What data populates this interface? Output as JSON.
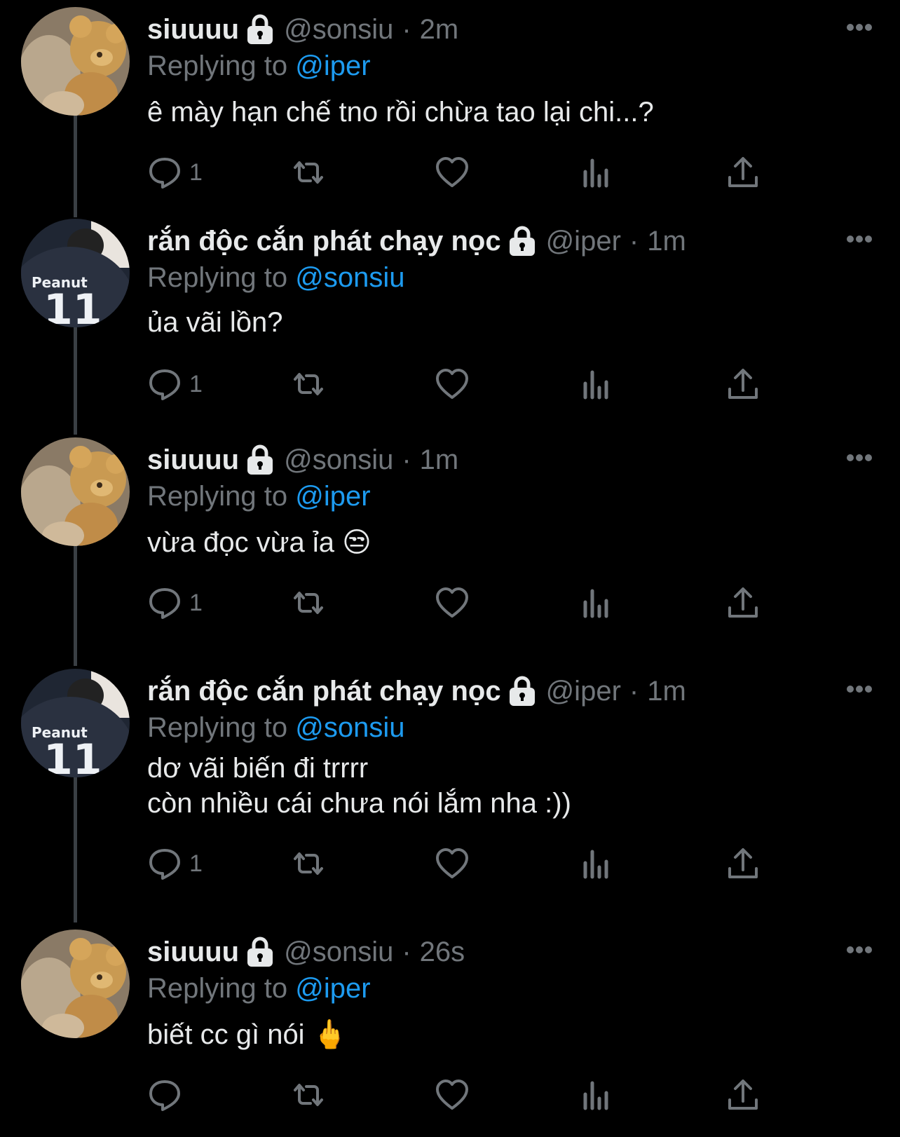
{
  "colors": {
    "background": "#000000",
    "text": "#e7e9ea",
    "muted": "#71767b",
    "link": "#1d9bf0"
  },
  "tweets": [
    {
      "name": "siuuuu",
      "handle": "@sonsiu",
      "separator": "·",
      "time": "2m",
      "replying_prefix": "Replying to",
      "replying_to": "@iper",
      "text": "ê mày hạn chế tno rồi chừa tao lại chi...?",
      "reply_count": "1",
      "avatar": "teddy-bear-avatar"
    },
    {
      "name": "rắn độc cắn phát chạy nọc",
      "handle": "@iper",
      "separator": "·",
      "time": "1m",
      "replying_prefix": "Replying to",
      "replying_to": "@sonsiu",
      "text": "ủa vãi lồn?",
      "reply_count": "1",
      "avatar": "peanut-jersey-avatar",
      "jersey_name": "Peanut",
      "jersey_number": "11"
    },
    {
      "name": "siuuuu",
      "handle": "@sonsiu",
      "separator": "·",
      "time": "1m",
      "replying_prefix": "Replying to",
      "replying_to": "@iper",
      "text": "vừa đọc vừa ỉa 😒",
      "reply_count": "1",
      "avatar": "teddy-bear-avatar"
    },
    {
      "name": "rắn độc cắn phát chạy nọc",
      "handle": "@iper",
      "separator": "·",
      "time": "1m",
      "replying_prefix": "Replying to",
      "replying_to": "@sonsiu",
      "text": "dơ vãi biến đi trrrr\ncòn nhiều cái chưa nói lắm nha :))",
      "reply_count": "1",
      "avatar": "peanut-jersey-avatar",
      "jersey_name": "Peanut",
      "jersey_number": "11"
    },
    {
      "name": "siuuuu",
      "handle": "@sonsiu",
      "separator": "·",
      "time": "26s",
      "replying_prefix": "Replying to",
      "replying_to": "@iper",
      "text": "biết cc gì nói 🖕",
      "reply_count": "",
      "avatar": "teddy-bear-avatar"
    }
  ]
}
